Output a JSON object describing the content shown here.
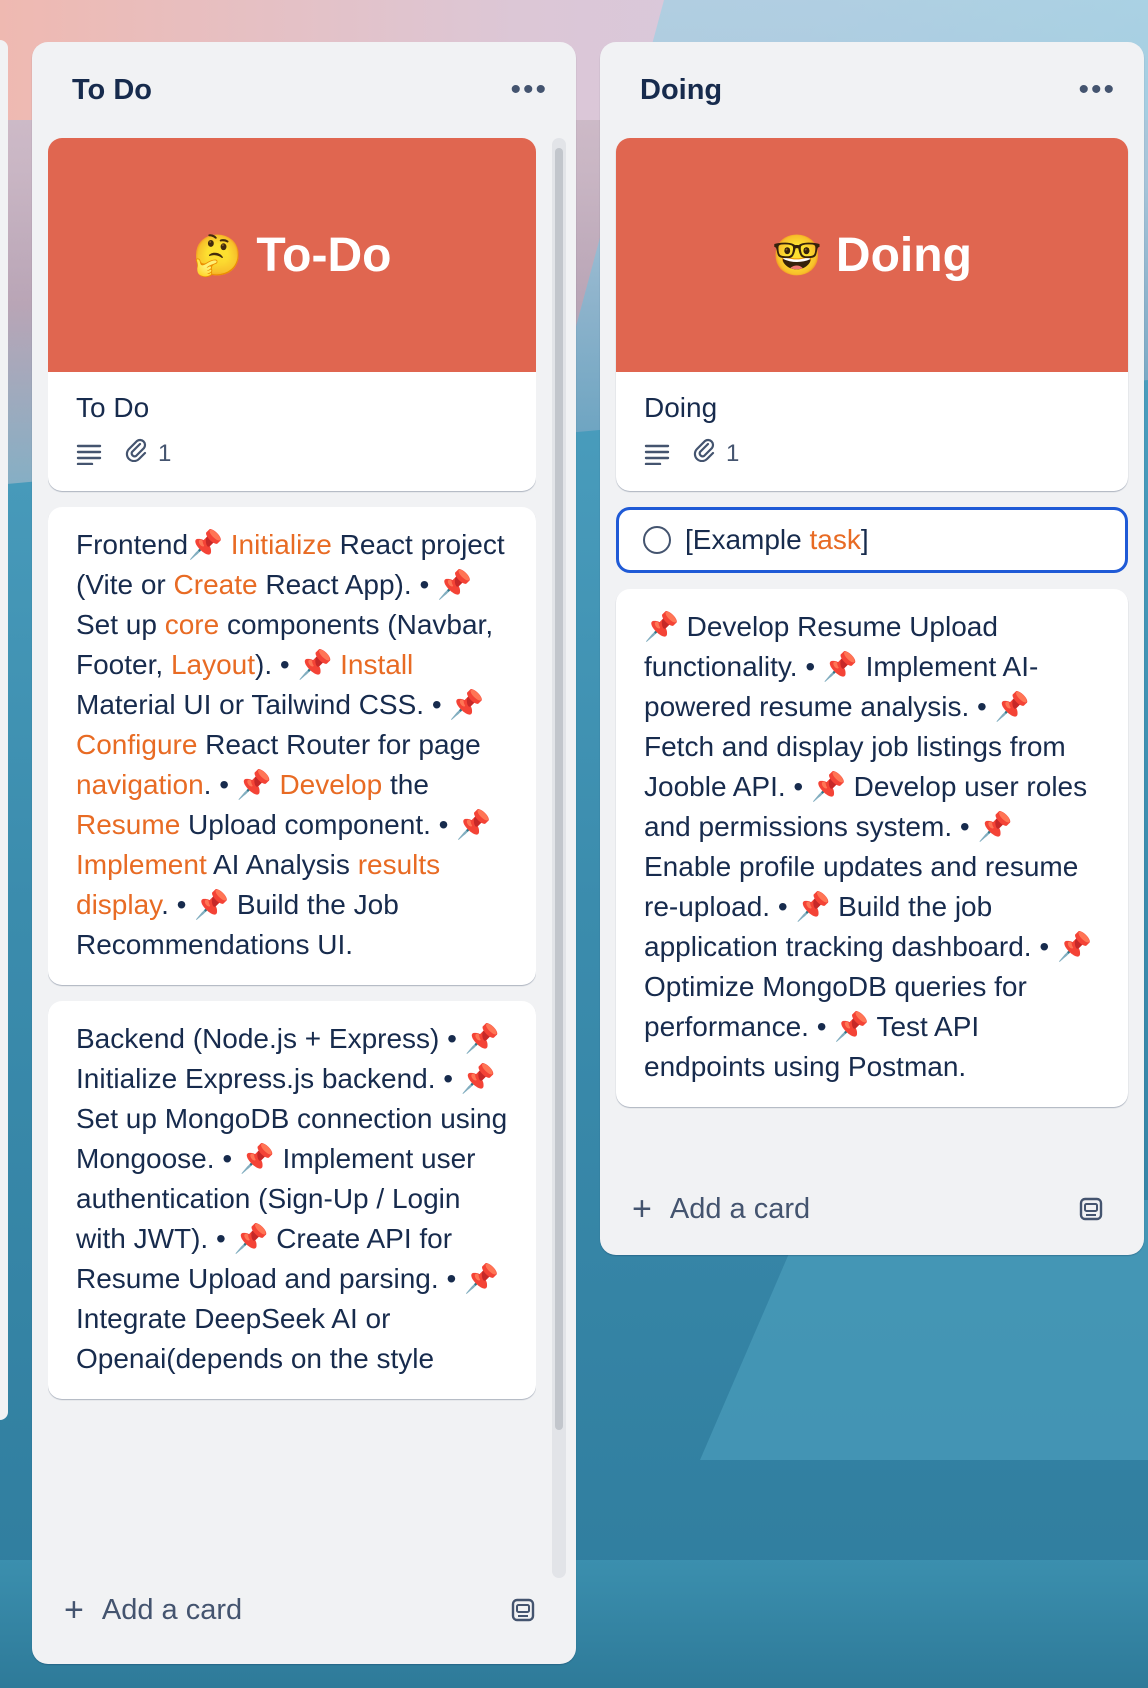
{
  "lists": {
    "todo": {
      "title": "To Do",
      "more_label": "•••",
      "cover_card": {
        "cover_emoji": "🤔",
        "cover_text": "To-Do",
        "title": "To Do",
        "attachment_count": "1"
      },
      "frontend_card": {
        "parts": [
          "Frontend📌 ",
          "Initialize",
          " React project (Vite or ",
          "Create",
          " React App). • 📌 Set up ",
          "core",
          " components (Navbar, Footer, ",
          "Layout",
          "). • 📌 ",
          "Install",
          " Material UI or Tailwind CSS. • 📌 ",
          "Configure",
          " React Router for page ",
          "navigation",
          ". • 📌 ",
          "Develop",
          " the ",
          "Resume",
          " Upload component. • 📌 ",
          "Implement",
          " AI Analysis ",
          "results display",
          ". • 📌 Build the Job Recommendations UI."
        ]
      },
      "backend_card": {
        "text": "Backend (Node.js + Express) • 📌 Initialize Express.js backend. • 📌 Set up MongoDB connection using Mongoose. • 📌 Implement user authentication (Sign-Up / Login with JWT). • 📌 Create API for Resume Upload and parsing. • 📌 Integrate DeepSeek AI or Openai(depends on the style"
      },
      "add_card_label": "Add a card"
    },
    "doing": {
      "title": "Doing",
      "more_label": "•••",
      "cover_card": {
        "cover_emoji": "🤓",
        "cover_text": "Doing",
        "title": "Doing",
        "attachment_count": "1"
      },
      "example_card": {
        "text_before": "[Example ",
        "text_highlight": "task",
        "text_after": "]"
      },
      "task_card": {
        "text": "📌 Develop Resume Upload functionality. • 📌 Implement AI-powered resume analysis. • 📌 Fetch and display job listings from Jooble API. • 📌 Develop user roles and permissions system. • 📌 Enable profile updates and resume re-upload. • 📌 Build the job application tracking dashboard. • 📌 Optimize MongoDB queries for performance. • 📌 Test API endpoints using Postman."
      },
      "add_card_label": "Add a card"
    }
  },
  "colors": {
    "cover": "#e06650",
    "highlight": "#e86b24",
    "focus_border": "#1f5ad6"
  }
}
